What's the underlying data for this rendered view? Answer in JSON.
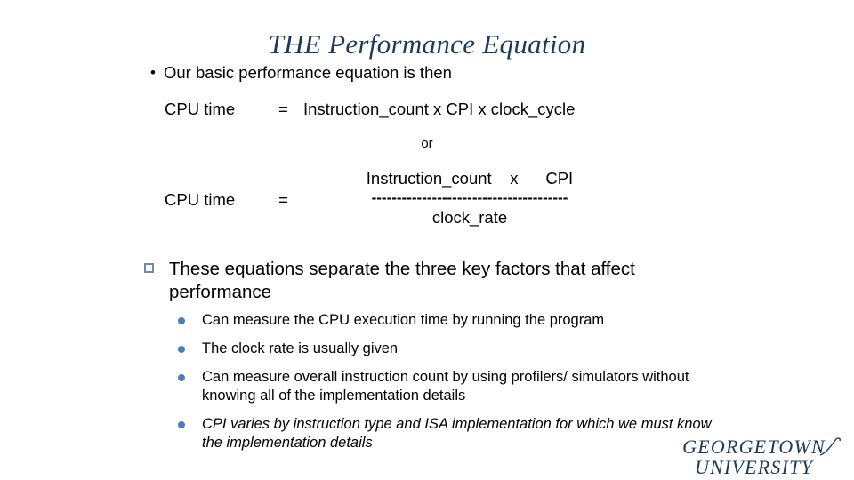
{
  "slide": {
    "title": "THE Performance Equation",
    "colors": {
      "title_navy": "#1b3a5c",
      "square_bullet": "#7089a8",
      "round_bullet": "#4a7ebb",
      "background": "#ffffff",
      "text": "#000000"
    }
  },
  "intro": {
    "marker": "bullet-dot",
    "text": "Our basic performance equation is then"
  },
  "equation_simple": {
    "lhs": "CPU time",
    "equals": "=",
    "rhs": "Instruction_count  x  CPI  x   clock_cycle"
  },
  "connector": {
    "text": "or"
  },
  "equation_fraction": {
    "lhs": "CPU time",
    "equals": "=",
    "numerator": "Instruction_count    x      CPI",
    "bar": "---------------------------------------",
    "denominator": "clock_rate"
  },
  "key_point": {
    "marker": "square-bullet",
    "text": "These equations separate the three key factors that affect performance"
  },
  "sub_bullets": [
    {
      "marker": "round-bullet",
      "text": "Can measure the CPU execution time by running the program",
      "italic": false
    },
    {
      "marker": "round-bullet",
      "text": "The clock rate is usually given",
      "italic": false
    },
    {
      "marker": "round-bullet",
      "text": "Can measure overall instruction count by using profilers/ simulators without knowing all of the implementation details",
      "italic": false
    },
    {
      "marker": "round-bullet",
      "text": "CPI varies by instruction type and ISA implementation for which we must know the implementation details",
      "italic": true
    }
  ],
  "logo": {
    "line1": "GEORGETOWN",
    "line2": "UNIVERSITY"
  }
}
